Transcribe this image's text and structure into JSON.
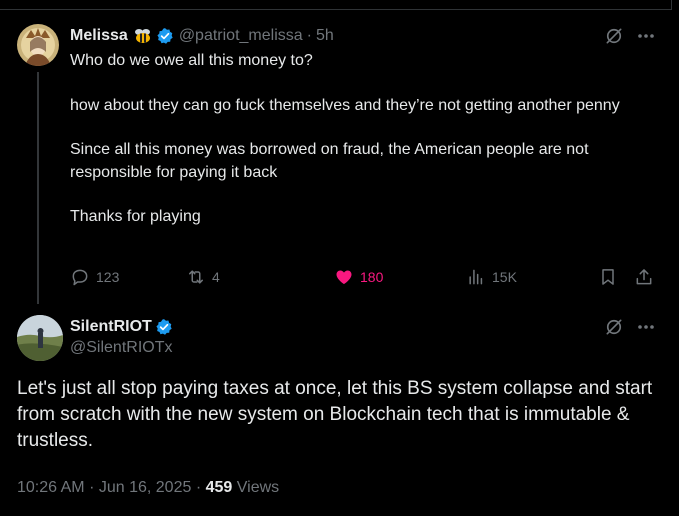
{
  "colors": {
    "background": "#000000",
    "text_primary": "#e7e9ea",
    "text_secondary": "#71767b",
    "verified_blue": "#1d9bf0",
    "like_pink": "#f91880",
    "divider": "#2f3336"
  },
  "reply_tweet": {
    "author": {
      "display_name": "Melissa",
      "emoji": "bee-emoji",
      "verified": true,
      "handle": "@patriot_melissa",
      "separator": "·",
      "time_ago": "5h"
    },
    "paragraphs": [
      "Who do we owe all this money to?",
      "how about they can go fuck themselves and they’re not getting another penny",
      "Since all this money was borrowed on fraud, the American people are not responsible for paying it back",
      "Thanks for playing"
    ],
    "actions": {
      "replies": "123",
      "reposts": "4",
      "likes": "180",
      "liked": true,
      "views": "15K"
    },
    "icons": [
      "grok-icon",
      "more-icon",
      "reply-icon",
      "repost-icon",
      "heart-icon",
      "views-icon",
      "bookmark-icon",
      "share-icon"
    ]
  },
  "main_tweet": {
    "author": {
      "display_name": "SilentRIOT",
      "verified": true,
      "handle": "@SilentRIOTx"
    },
    "text": "Let's just all stop paying taxes at once, let this BS system collapse and start from scratch with the new system on Blockchain tech that is immutable & trustless.",
    "meta": {
      "time": "10:26 AM",
      "separator": "·",
      "date": "Jun 16, 2025",
      "views_count": "459",
      "views_label": "Views"
    }
  }
}
